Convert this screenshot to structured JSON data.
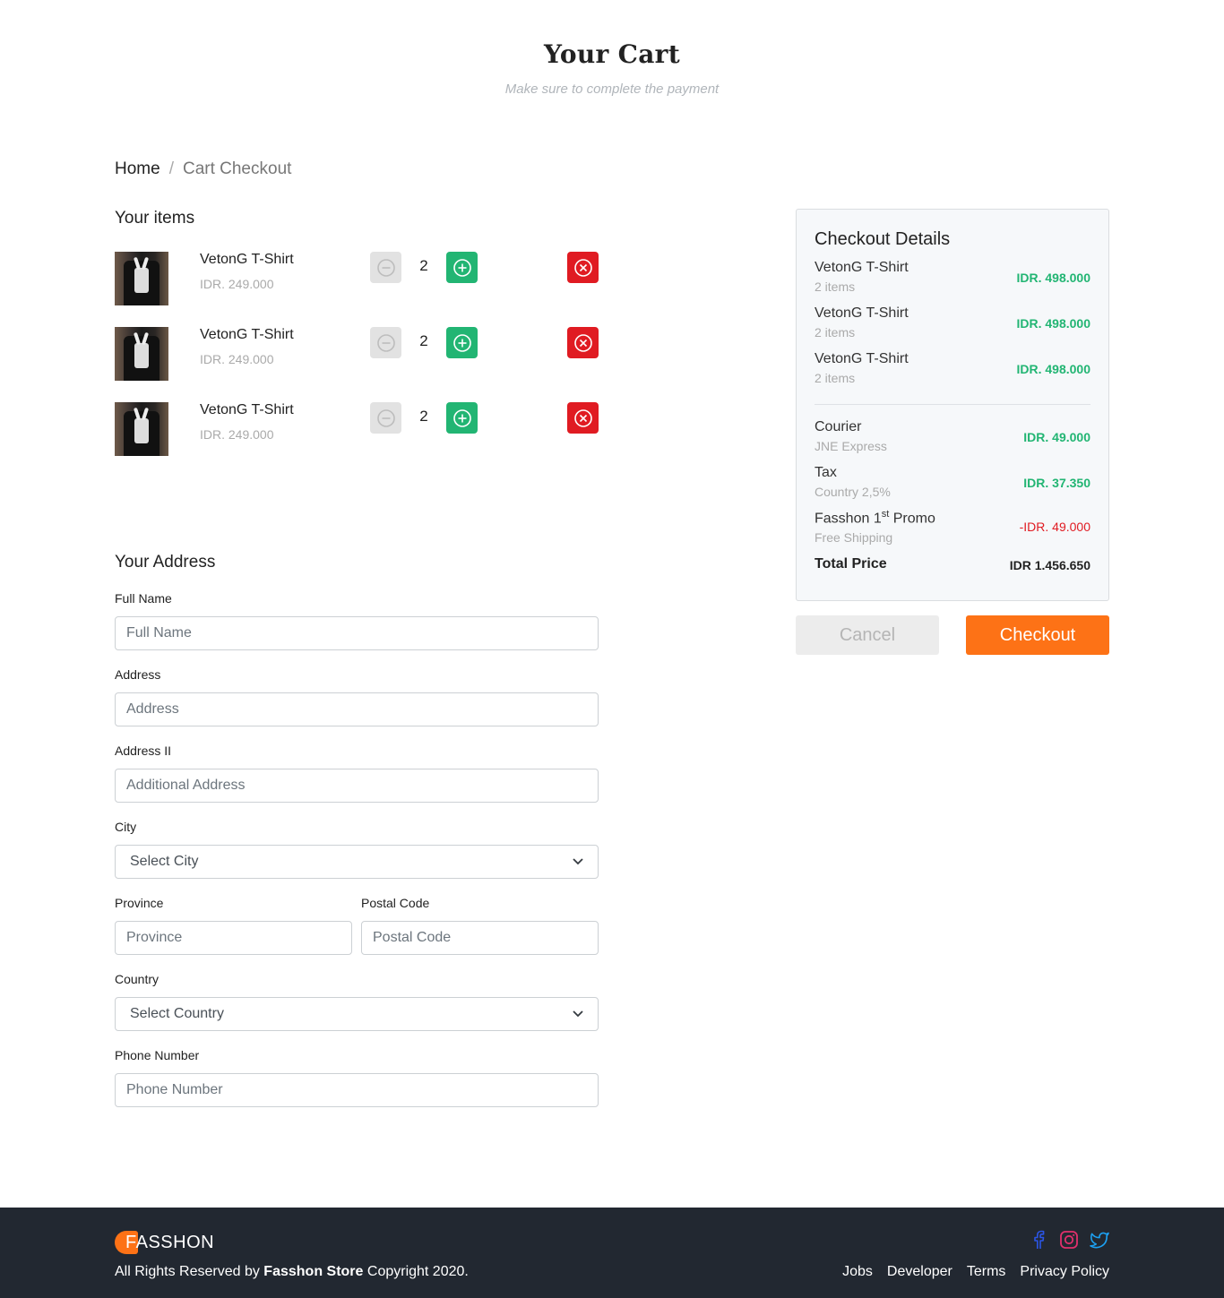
{
  "hero": {
    "title": "Your Cart",
    "subtitle": "Make sure to complete the payment"
  },
  "breadcrumb": {
    "home": "Home",
    "separator": "/",
    "current": "Cart Checkout"
  },
  "items_section": {
    "title": "Your items",
    "items": [
      {
        "name": "VetonG T-Shirt",
        "price": "IDR. 249.000",
        "quantity": "2"
      },
      {
        "name": "VetonG T-Shirt",
        "price": "IDR. 249.000",
        "quantity": "2"
      },
      {
        "name": "VetonG T-Shirt",
        "price": "IDR. 249.000",
        "quantity": "2"
      }
    ]
  },
  "address": {
    "title": "Your Address",
    "full_name": {
      "label": "Full Name",
      "placeholder": "Full Name"
    },
    "address1": {
      "label": "Address",
      "placeholder": "Address"
    },
    "address2": {
      "label": "Address II",
      "placeholder": "Additional Address"
    },
    "city": {
      "label": "City",
      "value": "Select City"
    },
    "province": {
      "label": "Province",
      "placeholder": "Province"
    },
    "postal": {
      "label": "Postal Code",
      "placeholder": "Postal Code"
    },
    "country": {
      "label": "Country",
      "value": "Select Country"
    },
    "phone": {
      "label": "Phone Number",
      "placeholder": "Phone Number"
    }
  },
  "checkout": {
    "title": "Checkout Details",
    "lines": [
      {
        "title": "VetonG T-Shirt",
        "sub": "2 items",
        "value": "IDR. 498.000"
      },
      {
        "title": "VetonG T-Shirt",
        "sub": "2 items",
        "value": "IDR. 498.000"
      },
      {
        "title": "VetonG T-Shirt",
        "sub": "2 items",
        "value": "IDR. 498.000"
      }
    ],
    "courier": {
      "title": "Courier",
      "sub": "JNE Express",
      "value": "IDR. 49.000"
    },
    "tax": {
      "title": "Tax",
      "sub": "Country 2,5%",
      "value": "IDR. 37.350"
    },
    "promo": {
      "title_pre": "Fasshon 1",
      "title_sup": "st",
      "title_post": " Promo",
      "sub": "Free Shipping",
      "value": "-IDR. 49.000"
    },
    "total": {
      "label": "Total Price",
      "value": "IDR 1.456.650"
    },
    "cancel_label": "Cancel",
    "checkout_label": "Checkout"
  },
  "footer": {
    "brand_first": "F",
    "brand_rest": "ASSHON",
    "copyright_pre": "All Rights Reserved by ",
    "copyright_brand": "Fasshon Store",
    "copyright_post": " Copyright 2020.",
    "links": [
      "Jobs",
      "Developer",
      "Terms",
      "Privacy Policy"
    ],
    "social_icons": [
      "facebook-icon",
      "instagram-icon",
      "twitter-icon"
    ]
  },
  "colors": {
    "accent": "#fd7216",
    "success": "#22b573",
    "danger": "#e01b22",
    "footer_bg": "#222831"
  }
}
